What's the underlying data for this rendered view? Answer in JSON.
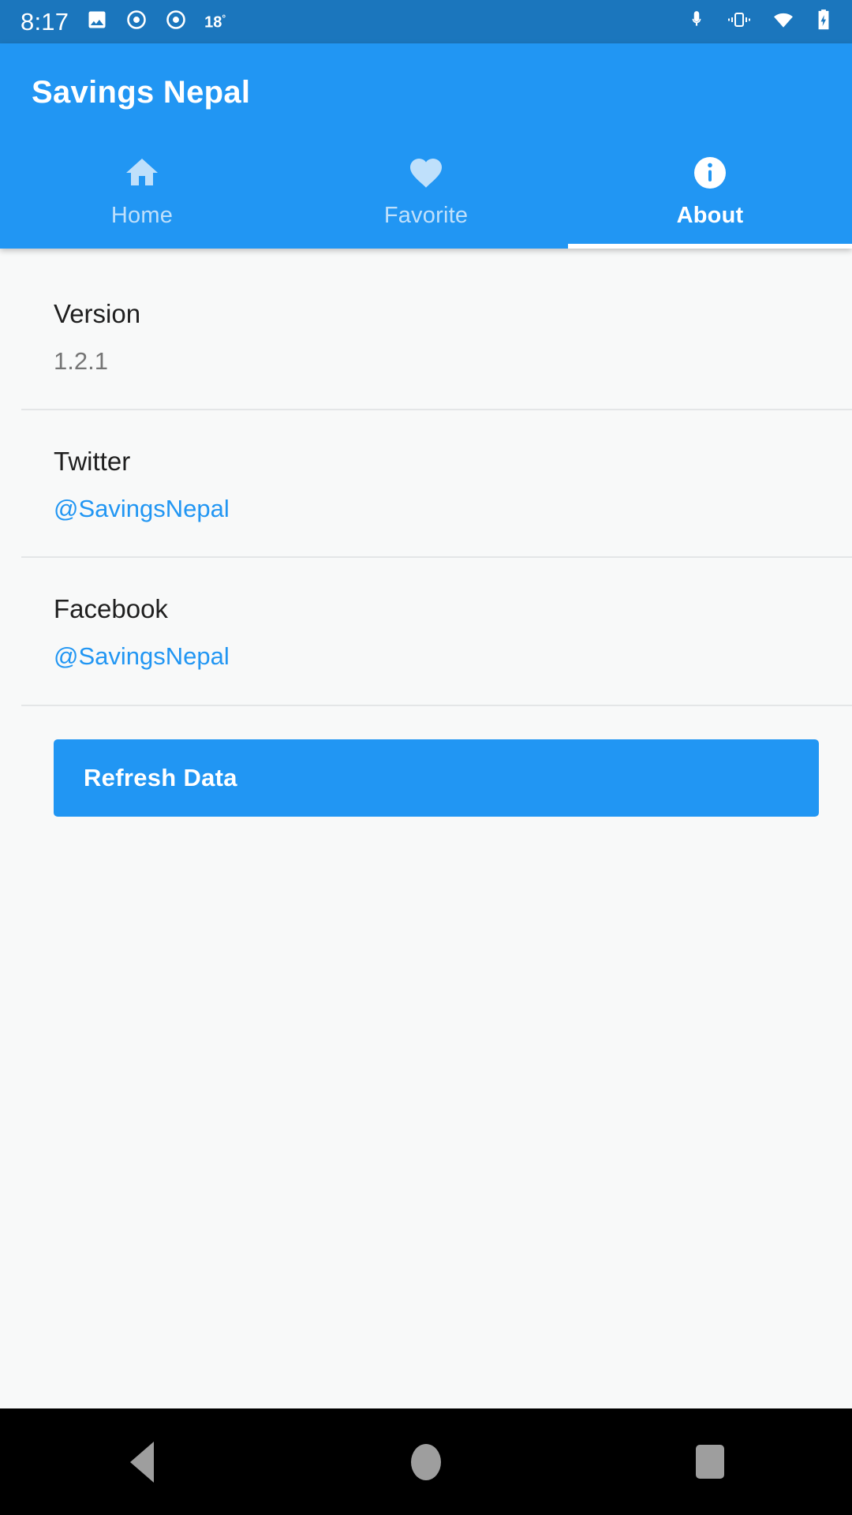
{
  "status_bar": {
    "time": "8:17",
    "temperature": "18",
    "degree_symbol": "°",
    "left_icons": [
      "image-icon",
      "record-circle-icon",
      "record-circle-icon"
    ],
    "right_icons": [
      "microphone-icon",
      "vibrate-icon",
      "wifi-icon",
      "battery-charging-icon"
    ],
    "background_color": "#1b76bd"
  },
  "app_bar": {
    "title": "Savings Nepal",
    "background_color": "#2196f3"
  },
  "tabs": [
    {
      "label": "Home",
      "icon": "home-icon",
      "active": false
    },
    {
      "label": "Favorite",
      "icon": "heart-icon",
      "active": false
    },
    {
      "label": "About",
      "icon": "info-circle-icon",
      "active": true
    }
  ],
  "about_list": [
    {
      "title": "Version",
      "value": "1.2.1",
      "is_link": false
    },
    {
      "title": "Twitter",
      "value": "@SavingsNepal",
      "is_link": true
    },
    {
      "title": "Facebook",
      "value": "@SavingsNepal",
      "is_link": true
    }
  ],
  "actions": {
    "refresh_label": "Refresh Data"
  },
  "nav_bar": {
    "back": "back-triangle-icon",
    "home": "home-circle-icon",
    "recents": "recents-square-icon"
  },
  "colors": {
    "accent": "#2196f3",
    "status_bar": "#1b76bd",
    "link": "#2196f3",
    "content_bg": "#f8f9f9",
    "inactive_tab": "#bfe0fb"
  }
}
